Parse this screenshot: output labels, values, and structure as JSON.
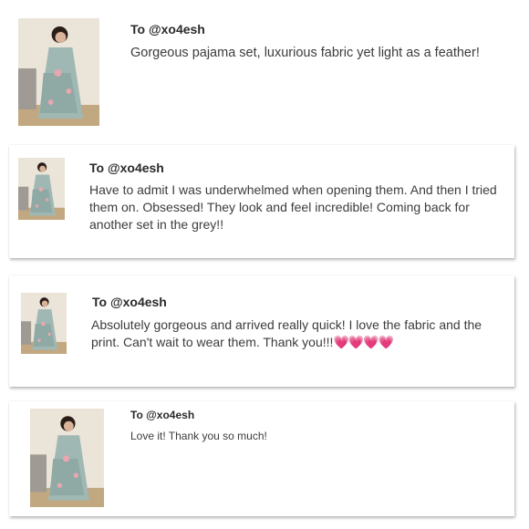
{
  "reviews": [
    {
      "to": "To @xo4esh",
      "text": "Gorgeous pajama set, luxurious fabric yet light as a feather!",
      "hearts": ""
    },
    {
      "to": "To @xo4esh",
      "text": "Have to admit I was underwhelmed when opening them. And then I tried them on. Obsessed! They look and feel incredible! Coming back for another set in the grey!!",
      "hearts": ""
    },
    {
      "to": "To @xo4esh",
      "text": "Absolutely gorgeous and arrived really quick! I love the fabric and the print. Can't wait to wear them. Thank you!!!",
      "hearts": "💗💗💗💗"
    },
    {
      "to": "To @xo4esh",
      "text": "Love it! Thank you so much!",
      "hearts": ""
    }
  ]
}
